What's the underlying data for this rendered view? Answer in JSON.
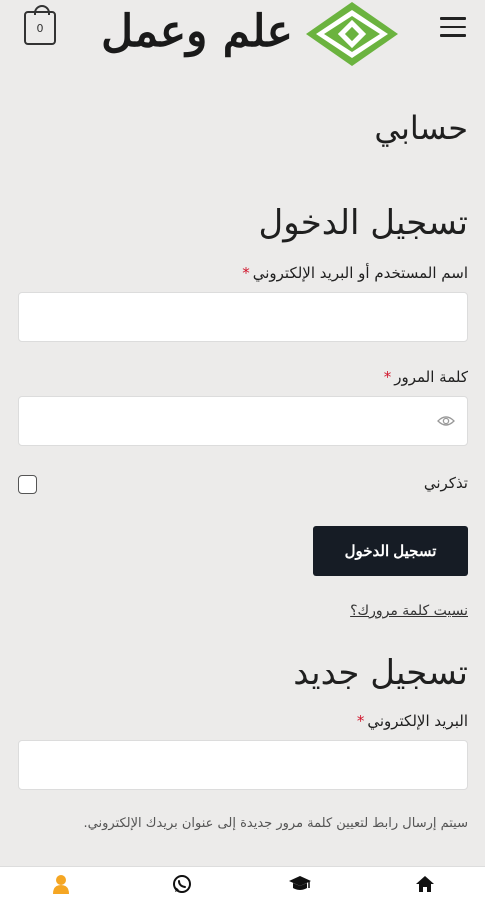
{
  "header": {
    "cart_count": "0",
    "logo_text": "علم وعمل"
  },
  "page": {
    "title": "حسابي"
  },
  "login": {
    "title": "تسجيل الدخول",
    "username_label": "اسم المستخدم أو البريد الإلكتروني",
    "required_mark": "*",
    "username_value": "",
    "password_label": "كلمة المرور",
    "password_value": "",
    "remember_label": "تذكرني",
    "remember_checked": false,
    "submit_label": "تسجيل الدخول",
    "forgot_label": "نسيت كلمة مرورك؟"
  },
  "register": {
    "title": "تسجيل جديد",
    "email_label": "البريد الإلكتروني",
    "email_value": "",
    "note": "سيتم إرسال رابط لتعيين كلمة مرور جديدة إلى عنوان بريدك الإلكتروني."
  },
  "bottom_nav": {
    "items": [
      "account-icon",
      "whatsapp-icon",
      "courses-icon",
      "home-icon"
    ],
    "active_color": "#f5a623"
  },
  "colors": {
    "background": "#ecebea",
    "button": "#161c25",
    "required": "#d0142b",
    "logo_green": "#6bb33f"
  }
}
